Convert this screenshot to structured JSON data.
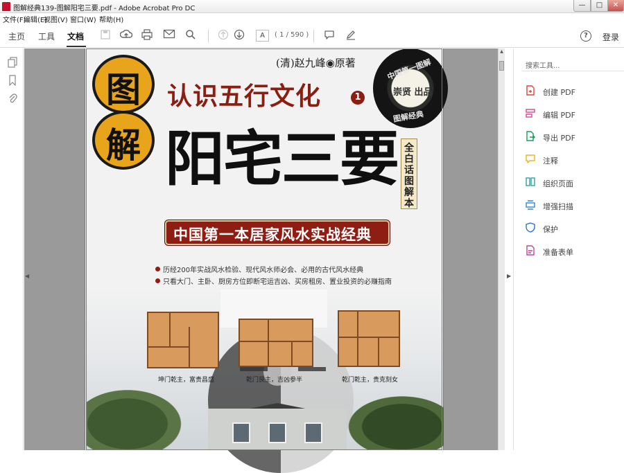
{
  "window": {
    "title": "图解经典139-图解阳宅三要.pdf - Adobe Acrobat Pro DC",
    "minimize": "—",
    "maximize": "□",
    "close": "✕"
  },
  "menu": [
    "文件(F)",
    "编辑(E)",
    "视图(V)",
    "窗口(W)",
    "帮助(H)"
  ],
  "nav_tabs": [
    "主页",
    "工具",
    "文档"
  ],
  "toolbar": {
    "page_input": "A",
    "page_count": "( 1 / 590 )",
    "icons": [
      "save-icon",
      "upload-icon",
      "print-icon",
      "email-icon",
      "search-icon",
      "prev-page-icon",
      "next-page-icon",
      "comment-icon",
      "pen-icon"
    ]
  },
  "header_right": {
    "help": "?",
    "signin": "登录"
  },
  "tools_pane": {
    "search_placeholder": "搜索工具...",
    "items": [
      {
        "label": "创建 PDF",
        "color": "#e0453a"
      },
      {
        "label": "编辑 PDF",
        "color": "#d9468c"
      },
      {
        "label": "导出 PDF",
        "color": "#1a9e57"
      },
      {
        "label": "注释",
        "color": "#f0b31c"
      },
      {
        "label": "组织页面",
        "color": "#2aa3a0"
      },
      {
        "label": "增强扫描",
        "color": "#2f86d4"
      },
      {
        "label": "保护",
        "color": "#2f6fd4"
      },
      {
        "label": "准备表单",
        "color": "#c2459b"
      }
    ]
  },
  "cover": {
    "badge_1": "图",
    "badge_2": "解",
    "author": "(清)赵九峰◉原著",
    "series_title": "认识五行文化",
    "series_num": "1",
    "main_title": "阳宅三要",
    "side_label": [
      "全",
      "白",
      "话",
      "图",
      "解",
      "本"
    ],
    "seal_ring": "中国第一图解",
    "seal_center": "崇贤 出品",
    "seal_bottom": "图解经典",
    "banner": "中国第一本居家风水实战经典",
    "bullets": [
      "历经200年实战风水检验、现代风水师必会、必用的古代风水经典",
      "只看大门、主卧、厨房方位即断宅运吉凶、买房租房、置业投资的必赚指南"
    ],
    "captions": [
      "坤门乾主，富贵昌盛",
      "乾门艮主，吉凶参半",
      "乾门乾主，贵克刻女"
    ]
  }
}
